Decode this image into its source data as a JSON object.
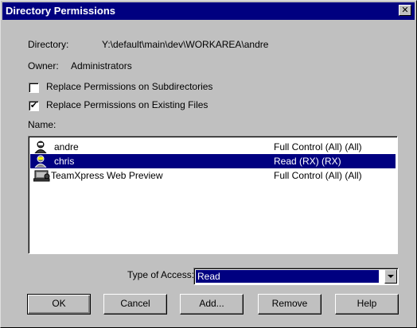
{
  "window": {
    "title": "Directory Permissions"
  },
  "info": {
    "directory_label": "Directory:",
    "directory_value": "Y:\\default\\main\\dev\\WORKAREA\\andre",
    "owner_label": "Owner:",
    "owner_value": "Administrators"
  },
  "options": {
    "replace_subdirs": {
      "label": "Replace Permissions on Subdirectories",
      "checked": false
    },
    "replace_files": {
      "label": "Replace Permissions on Existing Files",
      "checked": true
    }
  },
  "list": {
    "label": "Name:",
    "rows": [
      {
        "name": "andre",
        "access": "Full Control (All) (All)",
        "icon": "user-icon",
        "selected": false
      },
      {
        "name": "chris",
        "access": "Read (RX) (RX)",
        "icon": "user-icon",
        "selected": true
      },
      {
        "name": "TeamXpress Web Preview",
        "access": "Full Control (All) (All)",
        "icon": "group-icon",
        "selected": false
      }
    ]
  },
  "access": {
    "label": "Type of Access:",
    "value": "Read"
  },
  "buttons": {
    "ok": "OK",
    "cancel": "Cancel",
    "add": "Add...",
    "remove": "Remove",
    "help": "Help"
  },
  "colors": {
    "title_bar": "#000080",
    "selection": "#000080",
    "face": "#c0c0c0"
  }
}
